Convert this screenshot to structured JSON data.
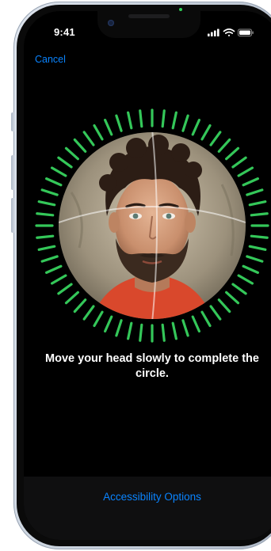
{
  "status_bar": {
    "time": "9:41",
    "icons": [
      "cellular-signal-icon",
      "wifi-icon",
      "battery-icon"
    ]
  },
  "nav": {
    "cancel_label": "Cancel"
  },
  "face_scan": {
    "instruction": "Move your head slowly to complete the circle.",
    "progress_color": "#34c759",
    "progress_fraction": 1.0
  },
  "bottom": {
    "accessibility_label": "Accessibility Options"
  },
  "colors": {
    "accent": "#0a84ff",
    "background": "#000000",
    "progress": "#34c759"
  }
}
